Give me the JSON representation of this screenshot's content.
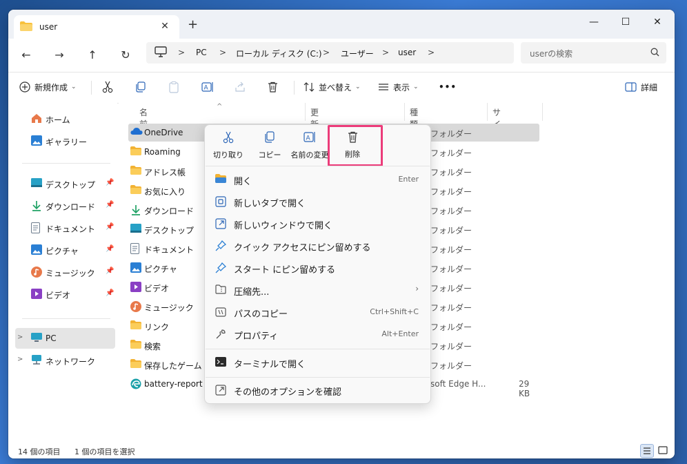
{
  "window": {
    "tab_title": "user",
    "new_tab": "+",
    "controls": [
      "—",
      "☐",
      "✕"
    ]
  },
  "nav": {
    "breadcrumb": [
      "PC",
      "ローカル ディスク (C:)",
      "ユーザー",
      "user"
    ],
    "search_placeholder": "userの検索"
  },
  "toolbar": {
    "new_label": "新規作成",
    "sort_label": "並べ替え",
    "view_label": "表示",
    "more_label": "•••",
    "details_label": "詳細"
  },
  "sidebar": {
    "items": [
      {
        "label": "ホーム",
        "icon": "home-icon"
      },
      {
        "label": "ギャラリー",
        "icon": "gallery-icon"
      },
      {
        "label": "デスクトップ",
        "icon": "desktop-icon"
      },
      {
        "label": "ダウンロード",
        "icon": "download-icon"
      },
      {
        "label": "ドキュメント",
        "icon": "document-icon"
      },
      {
        "label": "ピクチャ",
        "icon": "picture-icon"
      },
      {
        "label": "ミュージック",
        "icon": "music-icon"
      },
      {
        "label": "ビデオ",
        "icon": "video-icon"
      },
      {
        "label": "PC",
        "icon": "pc-icon"
      },
      {
        "label": "ネットワーク",
        "icon": "network-icon"
      }
    ]
  },
  "columns": {
    "name": "名前",
    "modified": "更新日時",
    "type": "種類",
    "size": "サイズ"
  },
  "files": [
    {
      "name": "OneDrive",
      "type": "フォルダー",
      "size": ""
    },
    {
      "name": "Roaming",
      "type": "フォルダー",
      "size": ""
    },
    {
      "name": "アドレス帳",
      "type": "フォルダー",
      "size": ""
    },
    {
      "name": "お気に入り",
      "type": "フォルダー",
      "size": ""
    },
    {
      "name": "ダウンロード",
      "type": "フォルダー",
      "size": ""
    },
    {
      "name": "デスクトップ",
      "type": "フォルダー",
      "size": ""
    },
    {
      "name": "ドキュメント",
      "type": "フォルダー",
      "size": ""
    },
    {
      "name": "ピクチャ",
      "type": "フォルダー",
      "size": ""
    },
    {
      "name": "ビデオ",
      "type": "フォルダー",
      "size": ""
    },
    {
      "name": "ミュージック",
      "type": "フォルダー",
      "size": ""
    },
    {
      "name": "リンク",
      "type": "フォルダー",
      "size": ""
    },
    {
      "name": "検索",
      "type": "フォルダー",
      "size": ""
    },
    {
      "name": "保存したゲーム",
      "type": "フォルダー",
      "size": ""
    },
    {
      "name": "battery-report",
      "type": "soft Edge H...",
      "size": "29 KB"
    }
  ],
  "context_menu": {
    "top_buttons": [
      {
        "label": "切り取り",
        "icon": "cut-icon"
      },
      {
        "label": "コピー",
        "icon": "copy-icon"
      },
      {
        "label": "名前の変更",
        "icon": "rename-icon"
      },
      {
        "label": "削除",
        "icon": "delete-icon"
      }
    ],
    "items": [
      {
        "label": "開く",
        "shortcut": "Enter"
      },
      {
        "label": "新しいタブで開く",
        "shortcut": ""
      },
      {
        "label": "新しいウィンドウで開く",
        "shortcut": ""
      },
      {
        "label": "クイック アクセスにピン留めする",
        "shortcut": ""
      },
      {
        "label": "スタート にピン留めする",
        "shortcut": ""
      },
      {
        "label": "圧縮先...",
        "shortcut": "›"
      },
      {
        "label": "パスのコピー",
        "shortcut": "Ctrl+Shift+C"
      },
      {
        "label": "プロパティ",
        "shortcut": "Alt+Enter"
      },
      {
        "label": "ターミナルで開く",
        "shortcut": ""
      },
      {
        "label": "その他のオプションを確認",
        "shortcut": ""
      }
    ],
    "highlight_color": "#ec3c7a"
  },
  "status": {
    "item_count": "14 個の項目",
    "selected_count": "1 個の項目を選択"
  }
}
